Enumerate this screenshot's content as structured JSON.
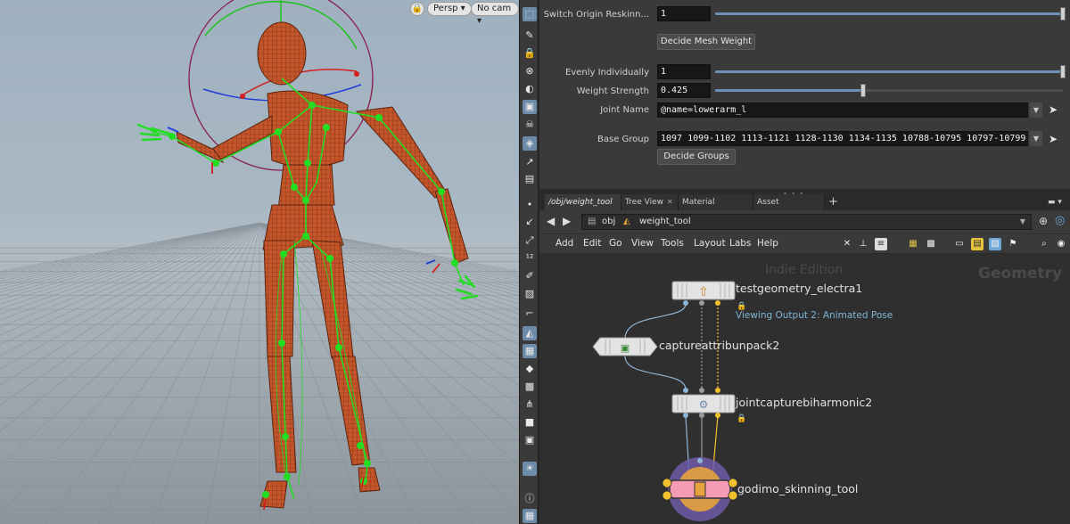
{
  "viewport": {
    "lock_icon": "lock-icon",
    "persp_label": "Persp",
    "cam_label": "No cam"
  },
  "parameters": {
    "switch_origin": {
      "label": "Switch Origin Reskinn...",
      "value": "1",
      "slider": 1.0
    },
    "decide_mesh_weight_button": "Decide Mesh Weight",
    "evenly_individually": {
      "label": "Evenly Individually",
      "value": "1",
      "slider": 1.0
    },
    "weight_strength": {
      "label": "Weight Strength",
      "value": "0.425",
      "slider": 0.425
    },
    "joint_name": {
      "label": "Joint Name",
      "value": "@name=lowerarm_l"
    },
    "base_group": {
      "label": "Base Group",
      "value": "1097 1099-1102 1113-1121 1128-1130 1134-1135 10788-10795 10797-10799 10"
    },
    "decide_groups_button": "Decide Groups"
  },
  "tabs": [
    {
      "label": "/obj/weight_tool",
      "active": true
    },
    {
      "label": "Tree View",
      "active": false
    },
    {
      "label": "Material Palette",
      "active": false
    },
    {
      "label": "Asset Browser",
      "active": false
    }
  ],
  "add_tab": "+",
  "path": {
    "root": "obj",
    "node": "weight_tool"
  },
  "menu": [
    "Add",
    "Edit",
    "Go",
    "View",
    "Tools",
    "Layout",
    "Labs",
    "Help"
  ],
  "network": {
    "watermark": "Indie Edition",
    "context": "Geometry",
    "nodes": [
      {
        "name": "testgeometry_electra1",
        "sub": "Viewing Output 2: Animated Pose"
      },
      {
        "name": "captureattribunpack2"
      },
      {
        "name": "jointcapturebiharmonic2"
      },
      {
        "name": "godimo_skinning_tool"
      }
    ]
  },
  "colors": {
    "accent_blue": "#6b8fb5",
    "wire_blue": "#8fb6d9",
    "wire_yellow": "#f2c12e",
    "wire_grey": "#9a9a9a",
    "skeleton_green": "#22dd22",
    "mesh_orange": "#c65a2e"
  }
}
